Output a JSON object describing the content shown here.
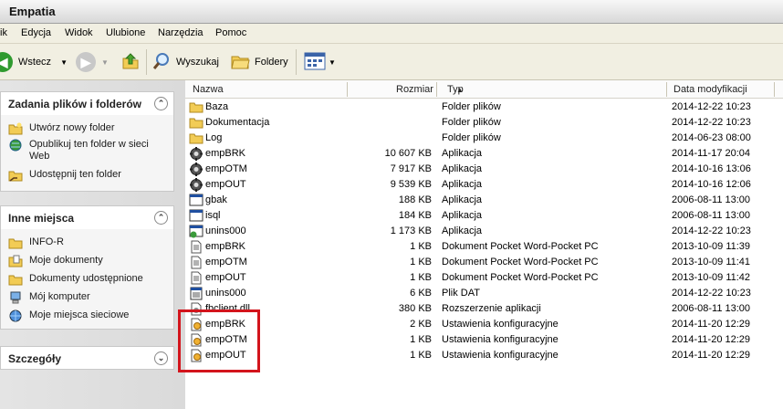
{
  "window": {
    "title": "Empatia"
  },
  "menu": [
    "ik",
    "Edycja",
    "Widok",
    "Ulubione",
    "Narzędzia",
    "Pomoc"
  ],
  "toolbar": {
    "back_label": "Wstecz",
    "search_label": "Wyszukaj",
    "folders_label": "Foldery"
  },
  "sidebar": {
    "tasks": {
      "title": "Zadania plików i folderów",
      "items": [
        "Utwórz nowy folder",
        "Opublikuj ten folder w sieci Web",
        "Udostępnij ten folder"
      ]
    },
    "places": {
      "title": "Inne miejsca",
      "items": [
        "INFO-R",
        "Moje dokumenty",
        "Dokumenty udostępnione",
        "Mój komputer",
        "Moje miejsca sieciowe"
      ]
    },
    "details": {
      "title": "Szczegóły"
    }
  },
  "columns": {
    "name": "Nazwa",
    "size": "Rozmiar",
    "type": "Typ",
    "modified": "Data modyfikacji"
  },
  "files": [
    {
      "name": "Baza",
      "size": "",
      "type": "Folder plików",
      "modified": "2014-12-22 10:23",
      "icon": "folder-icon"
    },
    {
      "name": "Dokumentacja",
      "size": "",
      "type": "Folder plików",
      "modified": "2014-12-22 10:23",
      "icon": "folder-icon"
    },
    {
      "name": "Log",
      "size": "",
      "type": "Folder plików",
      "modified": "2014-06-23 08:00",
      "icon": "folder-icon"
    },
    {
      "name": "empBRK",
      "size": "10 607 KB",
      "type": "Aplikacja",
      "modified": "2014-11-17 20:04",
      "icon": "gear-app-icon"
    },
    {
      "name": "empOTM",
      "size": "7 917 KB",
      "type": "Aplikacja",
      "modified": "2014-10-16 13:06",
      "icon": "gear-app-icon"
    },
    {
      "name": "empOUT",
      "size": "9 539 KB",
      "type": "Aplikacja",
      "modified": "2014-10-16 12:06",
      "icon": "gear-app-icon"
    },
    {
      "name": "gbak",
      "size": "188 KB",
      "type": "Aplikacja",
      "modified": "2006-08-11 13:00",
      "icon": "console-app-icon"
    },
    {
      "name": "isql",
      "size": "184 KB",
      "type": "Aplikacja",
      "modified": "2006-08-11 13:00",
      "icon": "console-app-icon"
    },
    {
      "name": "unins000",
      "size": "1 173 KB",
      "type": "Aplikacja",
      "modified": "2014-12-22 10:23",
      "icon": "uninstall-icon"
    },
    {
      "name": "empBRK",
      "size": "1 KB",
      "type": "Dokument Pocket Word-Pocket PC",
      "modified": "2013-10-09 11:39",
      "icon": "document-icon"
    },
    {
      "name": "empOTM",
      "size": "1 KB",
      "type": "Dokument Pocket Word-Pocket PC",
      "modified": "2013-10-09 11:41",
      "icon": "document-icon"
    },
    {
      "name": "empOUT",
      "size": "1 KB",
      "type": "Dokument Pocket Word-Pocket PC",
      "modified": "2013-10-09 11:42",
      "icon": "document-icon"
    },
    {
      "name": "unins000",
      "size": "6 KB",
      "type": "Plik DAT",
      "modified": "2014-12-22 10:23",
      "icon": "dat-file-icon"
    },
    {
      "name": "fbclient.dll",
      "size": "380 KB",
      "type": "Rozszerzenie aplikacji",
      "modified": "2006-08-11 13:00",
      "icon": "dll-icon"
    },
    {
      "name": "empBRK",
      "size": "2 KB",
      "type": "Ustawienia konfiguracyjne",
      "modified": "2014-11-20 12:29",
      "icon": "config-file-icon"
    },
    {
      "name": "empOTM",
      "size": "1 KB",
      "type": "Ustawienia konfiguracyjne",
      "modified": "2014-11-20 12:29",
      "icon": "config-file-icon"
    },
    {
      "name": "empOUT",
      "size": "1 KB",
      "type": "Ustawienia konfiguracyjne",
      "modified": "2014-11-20 12:29",
      "icon": "config-file-icon"
    }
  ],
  "colors": {
    "highlight": "#d3141c",
    "back_arrow": "#2f9a2f",
    "up_arrow": "#4aa52e"
  }
}
